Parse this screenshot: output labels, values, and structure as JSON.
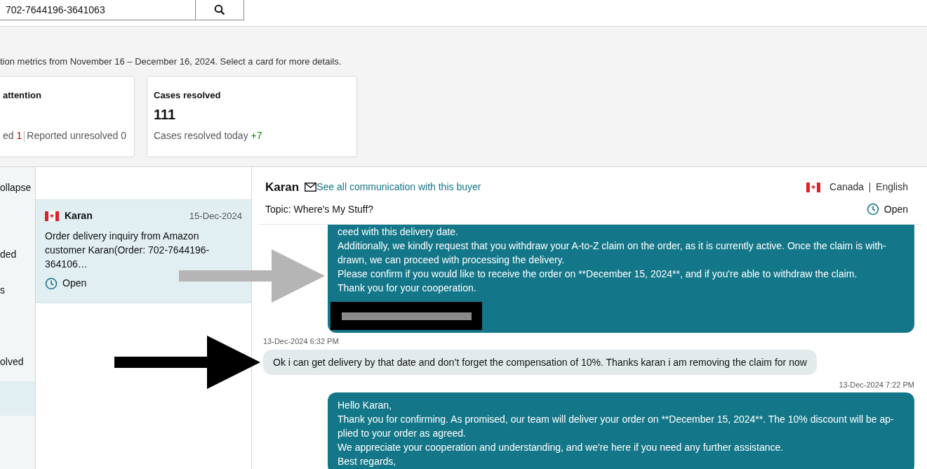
{
  "search": {
    "value": "702-7644196-3641063"
  },
  "metrics": {
    "intro": "tion metrics from November 16 – December 16, 2024. Select a card for more details.",
    "cards": [
      {
        "title": "attention",
        "footer": [
          {
            "text": "ed "
          },
          {
            "text": "1",
            "color": "#c40000"
          },
          {
            "text": "Reported unresolved 0",
            "divider": true
          }
        ]
      },
      {
        "title": "Cases resolved",
        "value": "111",
        "footer": [
          {
            "text": "Cases resolved today "
          },
          {
            "text": "+7",
            "color": "#067d00"
          }
        ]
      }
    ]
  },
  "sidebar": {
    "items": [
      {
        "label": "ollapse",
        "selected": false
      },
      {
        "label": "ded",
        "selected": false
      },
      {
        "label": "s",
        "selected": false
      },
      {
        "label": "olved",
        "selected": false
      },
      {
        "selected": true
      }
    ]
  },
  "cases": [
    {
      "name": "Karan",
      "date": "15-Dec-2024",
      "summary": "Order delivery inquiry from Amazon customer Karan(Order: 702-7644196-364106…",
      "status": "Open",
      "selected": true
    }
  ],
  "conversation": {
    "buyer": "Karan",
    "link": "See all communication with this buyer",
    "country": "Canada",
    "language": "English",
    "topic": "Topic: Where's My Stuff?",
    "status": "Open",
    "messages": [
      {
        "kind": "sent",
        "lines": [
          "ceed with this delivery date.",
          "Additionally, we kindly request that you withdraw your A-to-Z claim on the order, as it is currently active. Once the claim is with-",
          "drawn, we can proceed with processing the delivery.",
          "Please confirm if you would like to receive the order on **December 15, 2024**, and if you're able to withdraw the claim.",
          "Thank you for your cooperation."
        ],
        "redacted": true
      },
      {
        "kind": "received",
        "time": "13-Dec-2024 6:32 PM",
        "lines": [
          "Ok i can get delivery by that date and don’t forget the compensation of 10%. Thanks karan i am removing the claim for now"
        ]
      },
      {
        "kind": "sent",
        "time": "13-Dec-2024 7:22 PM",
        "lines": [
          "Hello Karan,",
          "Thank you for confirming. As promised, our team will deliver your order on **December 15, 2024**. The 10% discount will be ap-",
          "plied to your order as agreed.",
          "We appreciate your cooperation and understanding, and we're here if you need any further assistance.",
          "Best regards,"
        ]
      }
    ]
  },
  "annotations": [
    {
      "color": "#b5b5b5"
    },
    {
      "color": "#000000"
    }
  ]
}
